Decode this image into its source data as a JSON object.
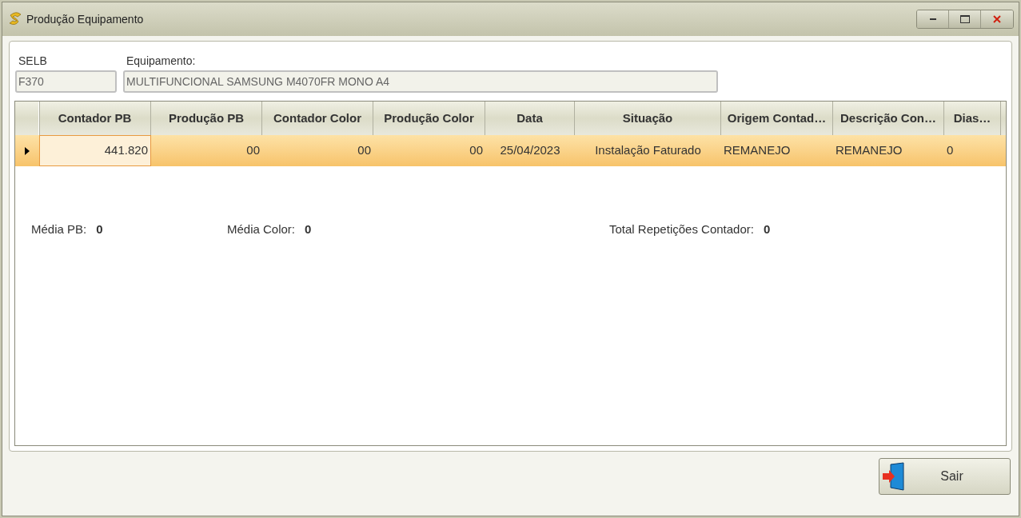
{
  "window": {
    "title": "Produção Equipamento"
  },
  "fields": [
    {
      "label": "SELB",
      "value": "F370"
    },
    {
      "label": "Equipamento:",
      "value": "MULTIFUNCIONAL SAMSUNG M4070FR MONO A4"
    }
  ],
  "table": {
    "columns": [
      "Contador PB",
      "Produção PB",
      "Contador Color",
      "Produção Color",
      "Data",
      "Situação",
      "Origem Contad…",
      "Descrição Con…",
      "Dias…"
    ],
    "rows": [
      {
        "selected": true,
        "cells": [
          {
            "text": "441.820",
            "current": true
          },
          {
            "text": "00",
            "current": false
          },
          {
            "text": "00",
            "current": false
          },
          {
            "text": "00",
            "current": false
          },
          {
            "text": "25/04/2023",
            "current": false
          },
          {
            "text": "Instalação Faturado",
            "current": false
          },
          {
            "text": "REMANEJO",
            "current": false
          },
          {
            "text": "REMANEJO",
            "current": false
          },
          {
            "text": "0",
            "current": false
          }
        ]
      }
    ]
  },
  "summary": [
    {
      "label": "Média PB:",
      "value": "0"
    },
    {
      "label": "Média Color:",
      "value": "0"
    },
    {
      "label": "Total Repetições Contador:",
      "value": "0"
    }
  ],
  "buttons": [
    {
      "label": "Sair"
    }
  ]
}
